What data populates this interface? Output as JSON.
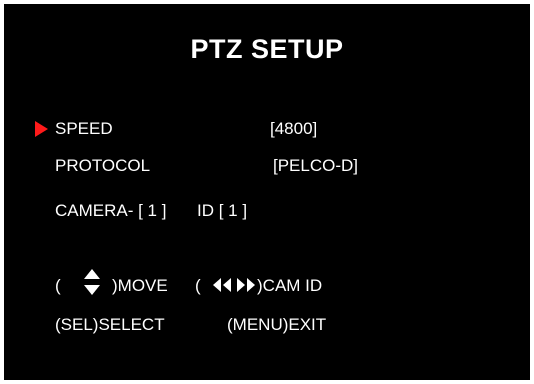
{
  "menu": {
    "title": "PTZ SETUP",
    "items": [
      {
        "label": "SPEED",
        "value": "[4800]",
        "selected": true
      },
      {
        "label": "PROTOCOL",
        "value": "[PELCO-D]",
        "selected": false
      },
      {
        "label": "CAMERA- [ 1 ]",
        "value": "ID [ 1 ]",
        "selected": false
      }
    ]
  },
  "help": {
    "move_open": "(",
    "move_label": ")MOVE",
    "camid_open": "(",
    "camid_label": ")CAM ID",
    "select_label": "(SEL)SELECT",
    "exit_label": "(MENU)EXIT"
  },
  "icons": {
    "cursor": "selection-arrow-icon",
    "move": "up-down-arrows-icon",
    "camid": "left-right-arrows-icon"
  },
  "colors": {
    "background": "#000000",
    "text": "#ffffff",
    "cursor": "#ff1a1a"
  }
}
